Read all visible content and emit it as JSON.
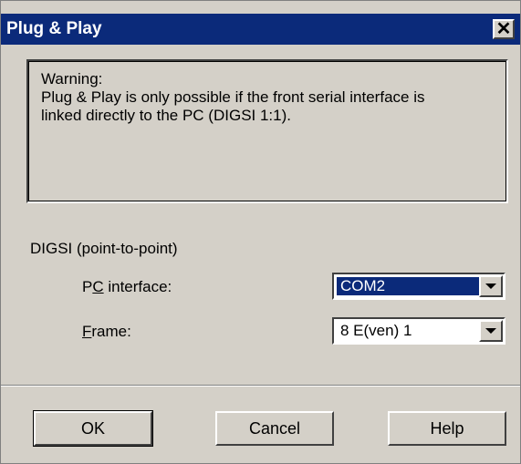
{
  "window": {
    "title": "Plug & Play",
    "close_glyph": "✕"
  },
  "warning": {
    "text": "Warning:\nPlug & Play is only possible if the front serial interface is\nlinked directly to the PC (DIGSI 1:1)."
  },
  "group": {
    "label": "DIGSI (point-to-point)"
  },
  "pc_interface": {
    "label_pre": "P",
    "label_accel": "C",
    "label_post": " interface:",
    "value": "COM2"
  },
  "frame": {
    "label_accel": "F",
    "label_post": "rame:",
    "value": "8 E(ven) 1"
  },
  "buttons": {
    "ok": "OK",
    "cancel": "Cancel",
    "help": "Help"
  },
  "colors": {
    "titlebar": "#0b2a7a",
    "face": "#d4d0c8",
    "selection": "#0b2a7a"
  }
}
